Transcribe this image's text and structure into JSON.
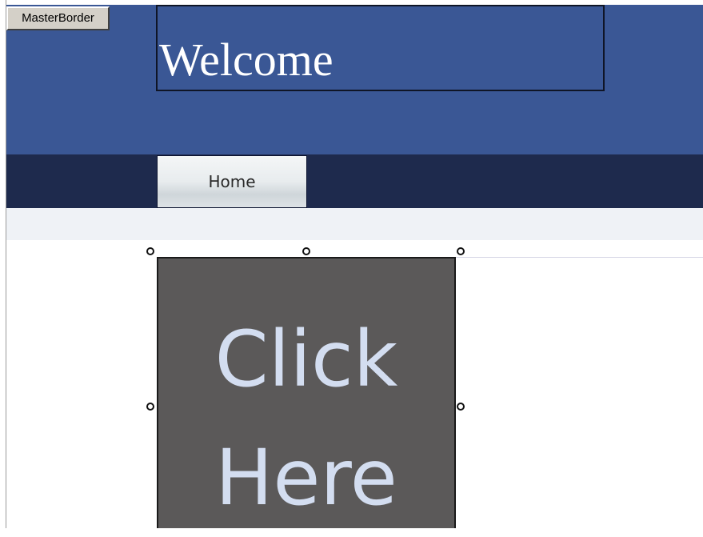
{
  "designer": {
    "master_tag": "MasterBorder"
  },
  "header": {
    "welcome": "Welcome"
  },
  "nav": {
    "home_label": "Home"
  },
  "content": {
    "button_line1": "Click",
    "button_line2": "Here"
  },
  "colors": {
    "header_bg": "#3a5795",
    "nav_bg": "#1e2a4d",
    "subbar_bg": "#eff2f6",
    "button_bg": "#5b5959",
    "button_text": "#d3ddf0"
  }
}
